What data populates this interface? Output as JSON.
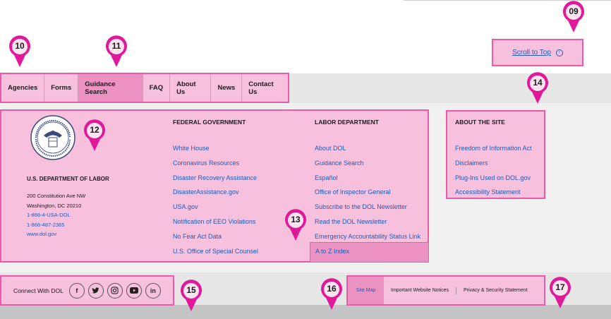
{
  "scroll_to_top": {
    "label": "Scroll to Top",
    "icon": "arrow-up-circle-icon"
  },
  "nav": {
    "items": [
      "Agencies",
      "Forms",
      "Guidance Search",
      "FAQ",
      "About Us",
      "News",
      "Contact Us"
    ],
    "active": "Guidance Search"
  },
  "org": {
    "name": "U.S. DEPARTMENT OF LABOR",
    "address1": "200 Constitution Ave NW",
    "address2": "Washington, DC 20210",
    "phone1": "1-866-4-USA-DOL",
    "phone2": "1-866-487-2365",
    "website": "www.dol.gov",
    "seal_text_top": "DEPARTMENT OF LABOR",
    "seal_text_bottom": "UNITED STATES OF AMERICA"
  },
  "federal_government": {
    "heading": "FEDERAL GOVERNMENT",
    "links": [
      "White House",
      "Coronavirus Resources",
      "Disaster Recovery Assistance",
      "DisasterAssistance.gov",
      "USA.gov",
      "Notification of EEO Violations",
      "No Fear Act Data",
      "U.S. Office of Special Counsel"
    ]
  },
  "labor_department": {
    "heading": "LABOR DEPARTMENT",
    "links": [
      "About DOL",
      "Guidance Search",
      "Español",
      "Office of Inspector General",
      "Subscribe to the DOL Newsletter",
      "Read the DOL Newsletter",
      "Emergency Accountability Status Link"
    ],
    "highlighted_link": "A to Z Index"
  },
  "about_site": {
    "heading": "ABOUT THE SITE",
    "links": [
      "Freedom of Information Act",
      "Disclaimers",
      "Plug-Ins Used on DOL.gov",
      "Accessibility Statement"
    ]
  },
  "connect": {
    "label": "Connect With DOL",
    "social": [
      {
        "name": "facebook-icon",
        "glyph": "f"
      },
      {
        "name": "twitter-icon",
        "glyph": "t"
      },
      {
        "name": "instagram-icon",
        "glyph": "◎"
      },
      {
        "name": "youtube-icon",
        "glyph": "▶"
      },
      {
        "name": "linkedin-icon",
        "glyph": "in"
      }
    ]
  },
  "footer_links": {
    "site_map": "Site Map",
    "notices": "Important Website Notices",
    "privacy": "Privacy & Security Statement"
  },
  "markers": [
    "09",
    "10",
    "11",
    "12",
    "13",
    "14",
    "15",
    "16",
    "17"
  ],
  "colors": {
    "highlight": "#f7c1dd",
    "active": "#ec92c3",
    "border": "#ec5ba8",
    "marker": "#e0189a",
    "link": "#1f5bb5"
  }
}
